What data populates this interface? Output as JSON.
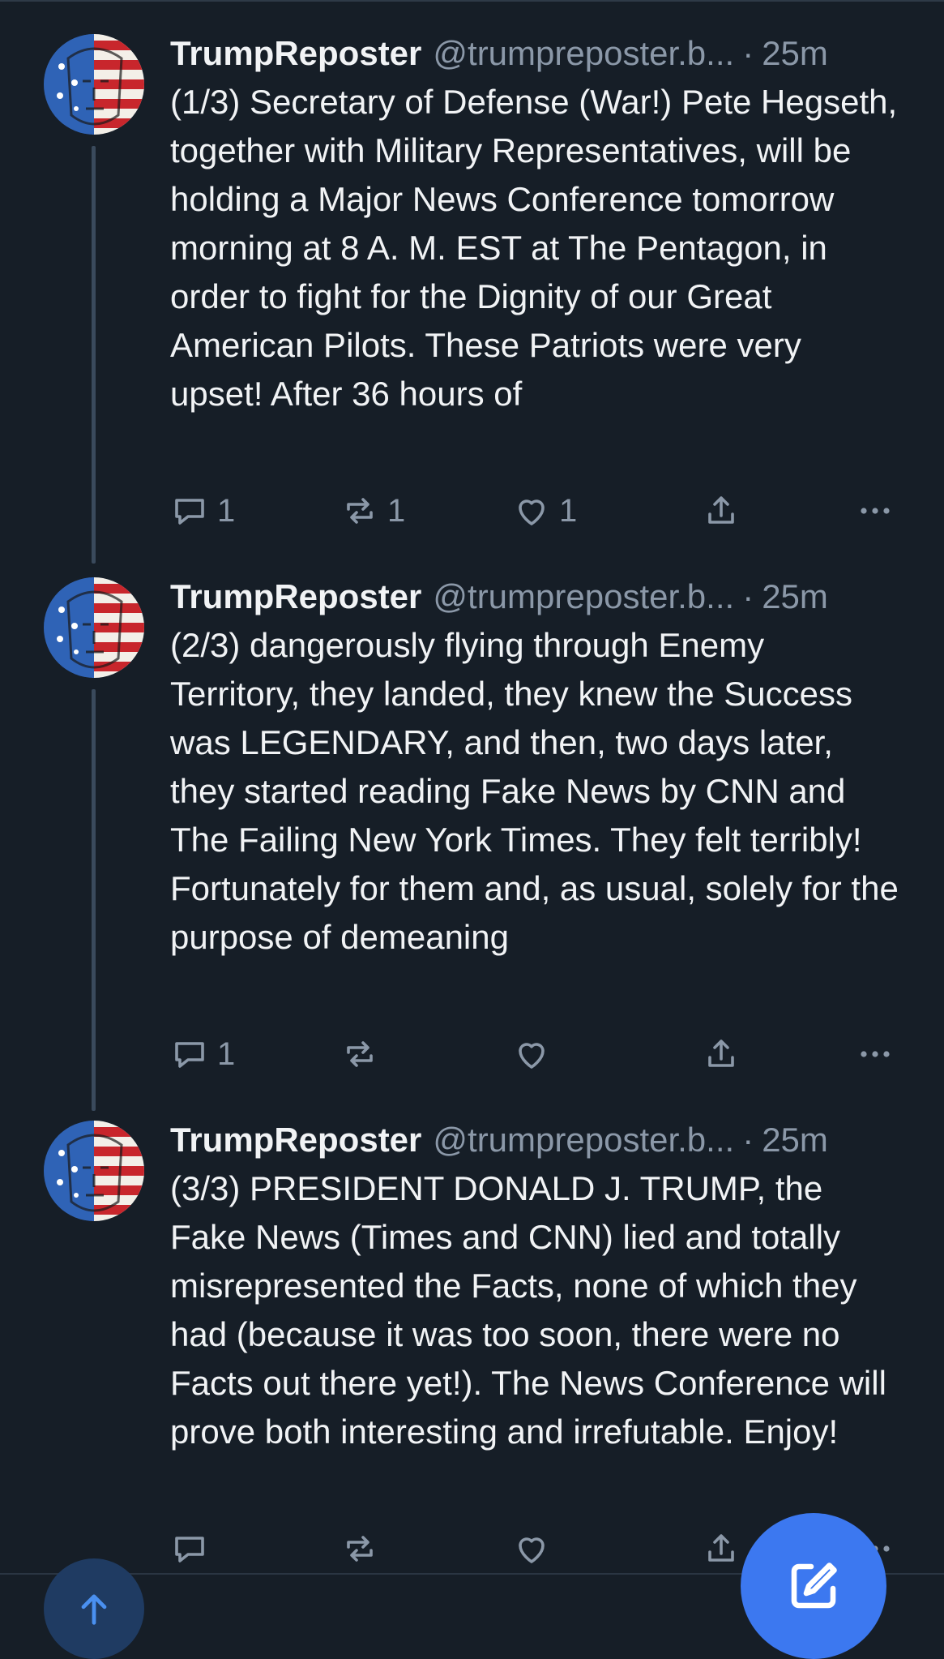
{
  "colors": {
    "background": "#161e27",
    "text": "#f1f3f5",
    "muted": "#8b98a8",
    "accent": "#3c78f0",
    "thread_line": "#3a4a5c"
  },
  "posts": [
    {
      "display_name": "TrumpReposter",
      "handle": "@trumpreposter.b...",
      "separator": "·",
      "time": "25m",
      "text": "(1/3) Secretary of Defense (War!) Pete Hegseth, together with Military Representatives, will be holding a Major News Conference tomorrow morning at 8 A. M. EST at The Pentagon, in order to fight for the Dignity of our Great American Pilots. These Patriots were very upset! After 36 hours of",
      "reply_count": "1",
      "repost_count": "1",
      "like_count": "1"
    },
    {
      "display_name": "TrumpReposter",
      "handle": "@trumpreposter.b...",
      "separator": "·",
      "time": "25m",
      "text": "(2/3) dangerously flying through Enemy Territory, they landed, they knew the Success was LEGENDARY, and then, two days later, they started reading Fake News by CNN and The Failing New York Times. They felt terribly! Fortunately for them and, as usual, solely for the purpose of demeaning",
      "reply_count": "1",
      "repost_count": "",
      "like_count": ""
    },
    {
      "display_name": "TrumpReposter",
      "handle": "@trumpreposter.b...",
      "separator": "·",
      "time": "25m",
      "text": "(3/3) PRESIDENT DONALD J. TRUMP, the Fake News (Times and CNN) lied and totally misrepresented the Facts, none of which they had (because it was too soon, there were no Facts out there yet!). The News Conference will prove both interesting and irrefutable. Enjoy!",
      "reply_count": "",
      "repost_count": "",
      "like_count": ""
    }
  ],
  "icons": {
    "reply": "reply-icon",
    "repost": "repost-icon",
    "like": "heart-icon",
    "share": "share-icon",
    "more": "more-icon",
    "compose": "compose-icon",
    "scroll_top": "arrow-up-icon"
  }
}
